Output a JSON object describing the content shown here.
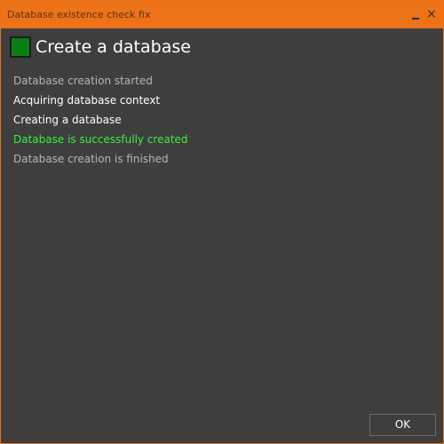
{
  "window": {
    "title": "Database existence check fix",
    "accent_color": "#ed7218",
    "minimize_icon": "minimize-icon",
    "close_icon": "close-icon",
    "close_glyph": "×"
  },
  "header": {
    "status_color": "#0a7d12",
    "title": "Create a database"
  },
  "log": {
    "lines": [
      {
        "text": "Database creation started",
        "color": "#b6b6b6"
      },
      {
        "text": "Acquiring database context",
        "color": "#ffffff"
      },
      {
        "text": "Creating a database",
        "color": "#ffffff"
      },
      {
        "text": "Database is successfully created",
        "color": "#3cf03c"
      },
      {
        "text": "Database creation is finished",
        "color": "#b6b6b6"
      }
    ]
  },
  "footer": {
    "ok_label": "OK"
  }
}
